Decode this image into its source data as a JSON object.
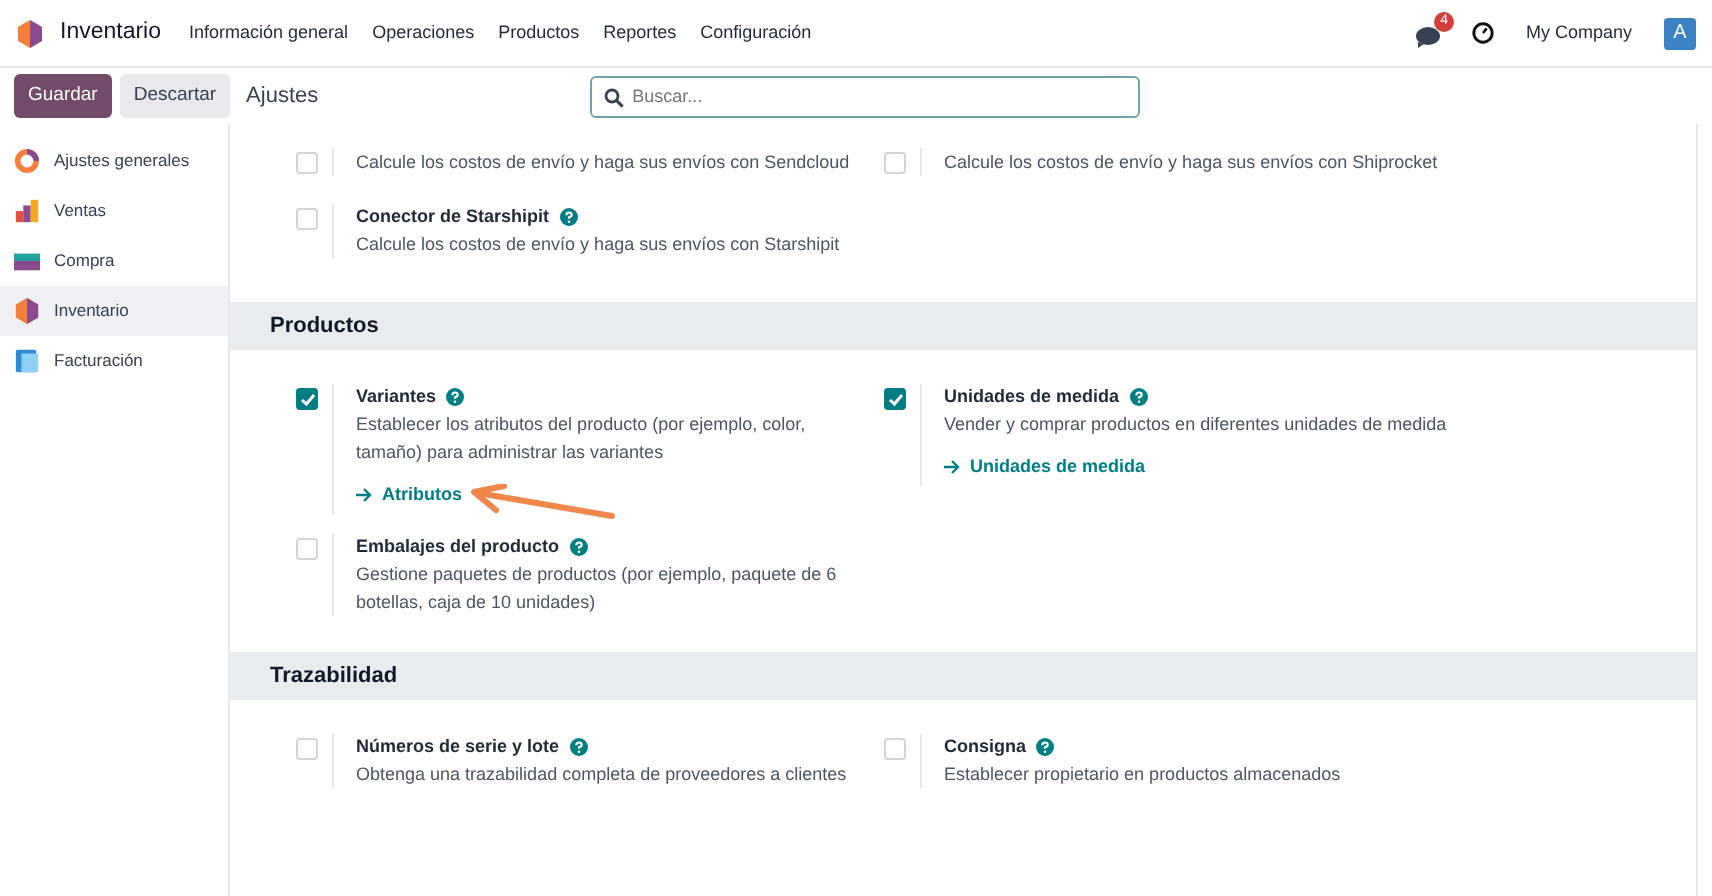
{
  "navbar": {
    "app": "Inventario",
    "menu": [
      "Información general",
      "Operaciones",
      "Productos",
      "Reportes",
      "Configuración"
    ],
    "chat_badge": "4",
    "company": "My Company",
    "avatar": "A"
  },
  "control_panel": {
    "buttons": [
      {
        "label": "Guardar",
        "kind": "primary"
      },
      {
        "label": "Descartar",
        "kind": "secondary"
      }
    ],
    "title": "Ajustes",
    "search": {
      "placeholder": "Buscar..."
    }
  },
  "sidebar": {
    "items": [
      {
        "label": "Ajustes generales",
        "selected": false
      },
      {
        "label": "Ventas",
        "selected": false
      },
      {
        "label": "Compra",
        "selected": false
      },
      {
        "label": "Inventario",
        "selected": true
      },
      {
        "label": "Facturación",
        "selected": false
      }
    ]
  },
  "sections": [
    {
      "settings": [
        {
          "description": "Calcule los costos de envío y haga sus envíos con Sendcloud",
          "checked": false
        },
        {
          "description": "Calcule los costos de envío y haga sus envíos con Shiprocket",
          "checked": false
        },
        {
          "title": "Conector de Starshipit",
          "description": "Calcule los costos de envío y haga sus envíos con Starshipit",
          "checked": false
        }
      ]
    },
    {
      "title": "Productos",
      "settings": [
        {
          "title": "Variantes",
          "description": "Establecer los atributos del producto (por ejemplo, color, tamaño) para administrar las variantes",
          "checked": true,
          "link": "Atributos"
        },
        {
          "title": "Unidades de medida",
          "description": "Vender y comprar productos en diferentes unidades de medida",
          "checked": true,
          "link": "Unidades de medida"
        },
        {
          "title": "Embalajes del producto",
          "description": "Gestione paquetes de productos (por ejemplo, paquete de 6 botellas, caja de 10 unidades)",
          "checked": false
        }
      ]
    },
    {
      "title": "Trazabilidad",
      "settings": [
        {
          "title": "Números de serie y lote",
          "description": "Obtenga una trazabilidad completa de proveedores a clientes",
          "checked": false
        },
        {
          "title": "Consigna",
          "description": "Establecer propietario en productos almacenados",
          "checked": false
        }
      ]
    }
  ]
}
